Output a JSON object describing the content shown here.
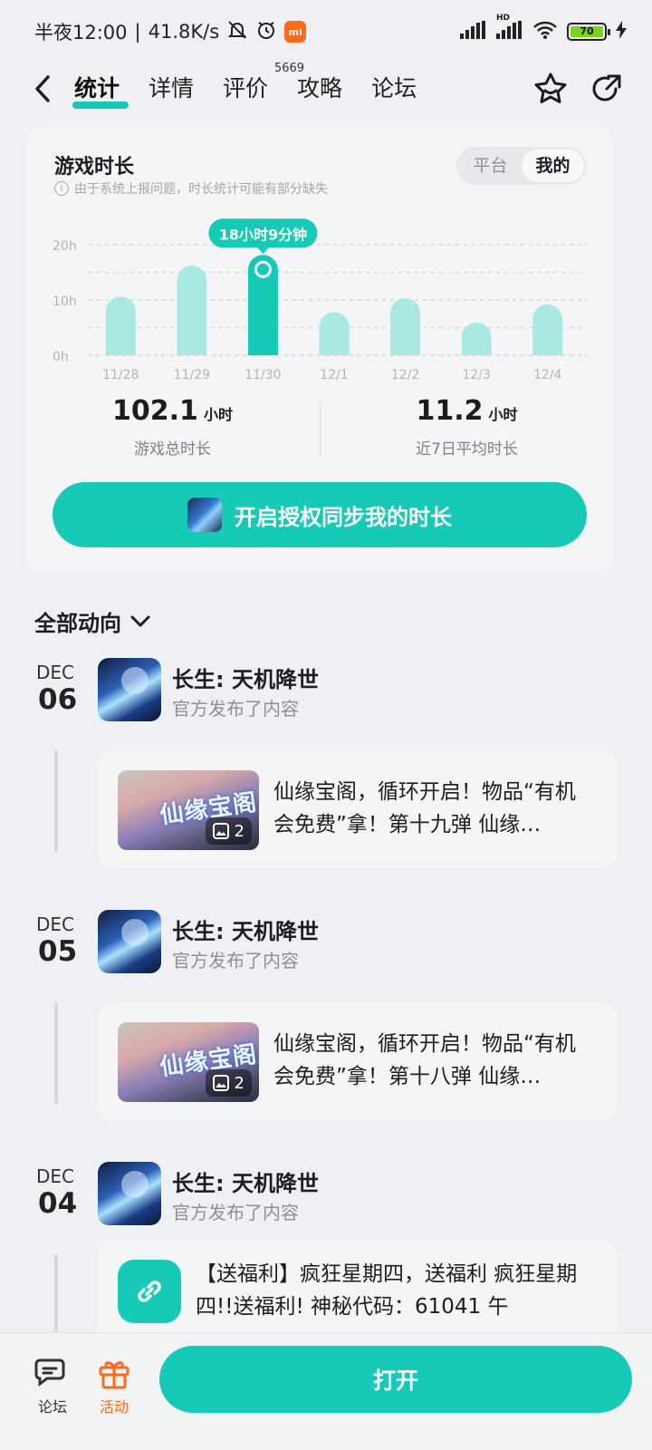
{
  "status_bar": {
    "time": "半夜12:00",
    "speed": "41.8K/s",
    "battery": "70",
    "hd_label": "HD",
    "mi_label": "mi"
  },
  "nav": {
    "tabs": [
      {
        "label": "统计",
        "active": true
      },
      {
        "label": "详情",
        "active": false
      },
      {
        "label": "评价",
        "active": false,
        "badge": "5669"
      },
      {
        "label": "攻略",
        "active": false
      },
      {
        "label": "论坛",
        "active": false
      }
    ]
  },
  "stats_card": {
    "title": "游戏时长",
    "note": "由于系统上报问题，时长统计可能有部分缺失",
    "segment": {
      "options": [
        "平台",
        "我的"
      ],
      "selected": "我的"
    },
    "total": {
      "value": "102.1",
      "unit": "小时",
      "label": "游戏总时长"
    },
    "average": {
      "value": "11.2",
      "unit": "小时",
      "label": "近7日平均时长"
    },
    "sync_button": "开启授权同步我的时长"
  },
  "chart_data": {
    "type": "bar",
    "categories": [
      "11/28",
      "11/29",
      "11/30",
      "12/1",
      "12/2",
      "12/3",
      "12/4"
    ],
    "values": [
      10.6,
      16.2,
      18.15,
      7.8,
      10.3,
      5.9,
      9.2
    ],
    "highlight_index": 2,
    "tooltip": "18小时9分钟",
    "y_ticks": [
      "0h",
      "10h",
      "20h"
    ],
    "ylim": [
      0,
      20
    ],
    "grid": true,
    "colors": {
      "bar": "#a9e9e1",
      "highlight": "#17c9b7"
    }
  },
  "feed": {
    "filter_label": "全部动向",
    "items": [
      {
        "month": "DEC",
        "day": "06",
        "game": "长生: 天机降世",
        "action": "官方发布了内容",
        "post_text": "仙缘宝阁，循环开启！物品“有机会免费”拿！第十九弹 仙缘…",
        "thumb_title": "仙缘宝阁",
        "image_count": "2"
      },
      {
        "month": "DEC",
        "day": "05",
        "game": "长生: 天机降世",
        "action": "官方发布了内容",
        "post_text": "仙缘宝阁，循环开启！物品“有机会免费”拿！第十八弹 仙缘…",
        "thumb_title": "仙缘宝阁",
        "image_count": "2"
      },
      {
        "month": "DEC",
        "day": "04",
        "game": "长生: 天机降世",
        "action": "官方发布了内容",
        "post_text": "【送福利】疯狂星期四，送福利 疯狂星期四!!送福利! 神秘代码：61041 午"
      }
    ]
  },
  "bottom_bar": {
    "forum_label": "论坛",
    "activity_label": "活动",
    "open_button": "打开"
  },
  "colors": {
    "accent": "#17c9b7",
    "activity": "#ff6a1a"
  }
}
